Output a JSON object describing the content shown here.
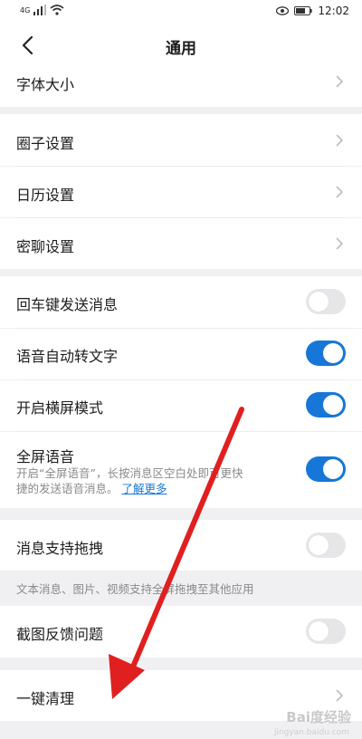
{
  "status_bar": {
    "network": "4G",
    "battery": "",
    "time": "12:02"
  },
  "header": {
    "title": "通用",
    "back_icon": "chevron-left-icon"
  },
  "rows": {
    "font_size": "字体大小",
    "circle_settings": "圈子设置",
    "calendar_settings": "日历设置",
    "secret_chat_settings": "密聊设置",
    "enter_send": "回车键发送消息",
    "voice_to_text": "语音自动转文字",
    "landscape_mode": "开启横屏模式",
    "fullscreen_voice": "全屏语音",
    "fullscreen_voice_desc_line1": "开启“全屏语音”，长按消息区空白处即可更快",
    "fullscreen_voice_desc_line2": "捷的发送语音消息。",
    "learn_more": "了解更多",
    "drag_support": "消息支持拖拽",
    "drag_hint": "文本消息、图片、视频支持全屏拖拽至其他应用",
    "screenshot_feedback": "截图反馈问题",
    "one_key_clean": "一键清理"
  },
  "toggles": {
    "enter_send": false,
    "voice_to_text": true,
    "landscape_mode": true,
    "fullscreen_voice": true,
    "drag_support": false,
    "screenshot_feedback": false
  },
  "colors": {
    "accent": "#1677d8",
    "arrow": "#e02020",
    "background": "#f0f0f2"
  },
  "watermark": {
    "text": "Bai度经验",
    "sub": "jingyan.baidu.com"
  }
}
